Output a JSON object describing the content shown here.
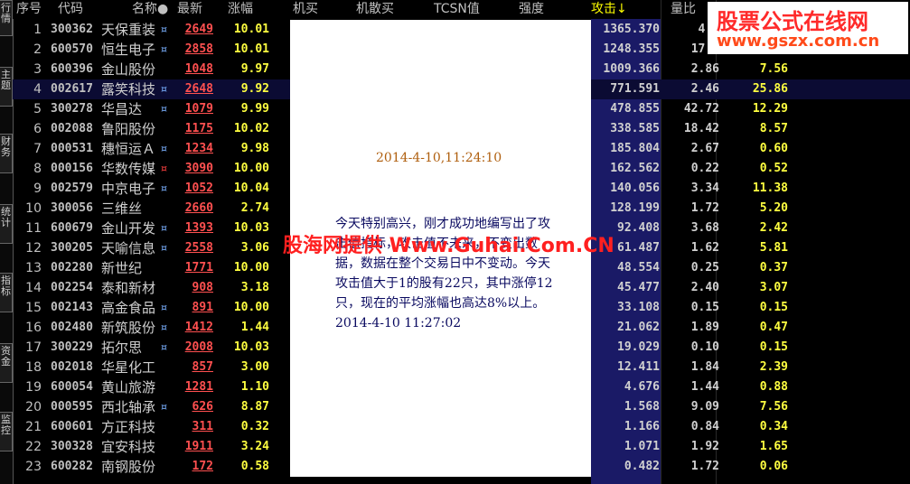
{
  "tabs": [
    "行情",
    "主题",
    "财务",
    "统计",
    "指标",
    "资金",
    "监控"
  ],
  "columns": {
    "seq": "序号",
    "code": "代码",
    "name": "名称●",
    "price": "最新",
    "pct": "涨幅",
    "jimai": "机买",
    "jisanmai": "机散买",
    "tcsn": "TCSN值",
    "strength": "强度",
    "attack": "攻击↓",
    "volratio": "量比"
  },
  "rows": [
    {
      "seq": "1",
      "code": "300362",
      "name": "天保重装",
      "mark": "¤",
      "price": "2649",
      "pct": "10.01",
      "attack": "1365.370",
      "vol": "4.9",
      "intensity": ""
    },
    {
      "seq": "2",
      "code": "600570",
      "name": "恒生电子",
      "mark": "¤",
      "price": "2858",
      "pct": "10.01",
      "attack": "1248.355",
      "vol": "17.9",
      "intensity": ""
    },
    {
      "seq": "3",
      "code": "600396",
      "name": "金山股份",
      "mark": "",
      "price": "1048",
      "pct": "9.97",
      "attack": "1009.366",
      "vol": "2.86",
      "intensity": "7.56"
    },
    {
      "seq": "4",
      "code": "002617",
      "name": "露笑科技",
      "mark": "¤",
      "price": "2648",
      "pct": "9.92",
      "attack": "771.591",
      "vol": "2.46",
      "intensity": "25.86"
    },
    {
      "seq": "5",
      "code": "300278",
      "name": "华昌达",
      "mark": "¤",
      "price": "1079",
      "pct": "9.99",
      "attack": "478.855",
      "vol": "42.72",
      "intensity": "12.29"
    },
    {
      "seq": "6",
      "code": "002088",
      "name": "鲁阳股份",
      "mark": "",
      "price": "1175",
      "pct": "10.02",
      "attack": "338.585",
      "vol": "18.42",
      "intensity": "8.57"
    },
    {
      "seq": "7",
      "code": "000531",
      "name": "穗恒运Ａ",
      "mark": "¤",
      "price": "1234",
      "pct": "9.98",
      "attack": "185.804",
      "vol": "2.67",
      "intensity": "0.60"
    },
    {
      "seq": "8",
      "code": "000156",
      "name": "华数传媒",
      "mark": "¤",
      "price": "3090",
      "pct": "10.00",
      "attack": "162.562",
      "vol": "0.22",
      "intensity": "0.52"
    },
    {
      "seq": "9",
      "code": "002579",
      "name": "中京电子",
      "mark": "¤",
      "price": "1052",
      "pct": "10.04",
      "attack": "140.056",
      "vol": "3.34",
      "intensity": "11.38"
    },
    {
      "seq": "10",
      "code": "300056",
      "name": "三维丝",
      "mark": "",
      "price": "2660",
      "pct": "2.74",
      "attack": "128.199",
      "vol": "1.72",
      "intensity": "5.20"
    },
    {
      "seq": "11",
      "code": "600679",
      "name": "金山开发",
      "mark": "¤",
      "price": "1393",
      "pct": "10.03",
      "attack": "92.408",
      "vol": "3.68",
      "intensity": "2.42"
    },
    {
      "seq": "12",
      "code": "300205",
      "name": "天喻信息",
      "mark": "¤",
      "price": "2558",
      "pct": "3.06",
      "attack": "61.487",
      "vol": "1.62",
      "intensity": "5.81"
    },
    {
      "seq": "13",
      "code": "002280",
      "name": "新世纪",
      "mark": "",
      "price": "1771",
      "pct": "10.00",
      "attack": "48.554",
      "vol": "0.25",
      "intensity": "0.37"
    },
    {
      "seq": "14",
      "code": "002254",
      "name": "泰和新材",
      "mark": "",
      "price": "908",
      "pct": "3.18",
      "attack": "45.477",
      "vol": "2.40",
      "intensity": "3.07"
    },
    {
      "seq": "15",
      "code": "002143",
      "name": "高金食品",
      "mark": "¤",
      "price": "891",
      "pct": "10.00",
      "attack": "33.108",
      "vol": "0.15",
      "intensity": "0.15"
    },
    {
      "seq": "16",
      "code": "002480",
      "name": "新筑股份",
      "mark": "¤",
      "price": "1412",
      "pct": "1.44",
      "attack": "21.062",
      "vol": "1.89",
      "intensity": "0.47"
    },
    {
      "seq": "17",
      "code": "300229",
      "name": "拓尔思",
      "mark": "¤",
      "price": "2008",
      "pct": "10.03",
      "attack": "19.029",
      "vol": "0.10",
      "intensity": "0.15"
    },
    {
      "seq": "18",
      "code": "002018",
      "name": "华星化工",
      "mark": "",
      "price": "857",
      "pct": "3.00",
      "attack": "12.411",
      "vol": "1.84",
      "intensity": "2.39"
    },
    {
      "seq": "19",
      "code": "600054",
      "name": "黄山旅游",
      "mark": "",
      "price": "1281",
      "pct": "1.10",
      "attack": "4.676",
      "vol": "1.44",
      "intensity": "0.88"
    },
    {
      "seq": "20",
      "code": "000595",
      "name": "西北轴承",
      "mark": "¤",
      "price": "626",
      "pct": "8.87",
      "attack": "1.568",
      "vol": "9.09",
      "intensity": "7.56"
    },
    {
      "seq": "21",
      "code": "600601",
      "name": "方正科技",
      "mark": "",
      "price": "311",
      "pct": "0.32",
      "attack": "1.166",
      "vol": "0.84",
      "intensity": "0.34"
    },
    {
      "seq": "22",
      "code": "300328",
      "name": "宜安科技",
      "mark": "",
      "price": "1911",
      "pct": "3.24",
      "attack": "1.071",
      "vol": "1.92",
      "intensity": "1.65"
    },
    {
      "seq": "23",
      "code": "600282",
      "name": "南钢股份",
      "mark": "",
      "price": "172",
      "pct": "0.58",
      "attack": "0.482",
      "vol": "1.72",
      "intensity": "0.06"
    }
  ],
  "popup": {
    "time": "2014-4-10,11:24:10",
    "note": "今天特别高兴，刚才成功地编写出了攻击值指标，攻击值不未来，不变出数据，数据在整个交易日中不变动。今天攻击值大于1的股有22只，其中涨停12只，现在的平均涨幅也高达8%以上。2014-4-10 11:27:02"
  },
  "watermark": "股海网提供 Www.Guhai.Com.CN",
  "logo": {
    "line1": "股票公式在线网",
    "line2": "www.gszx.com.cn"
  }
}
